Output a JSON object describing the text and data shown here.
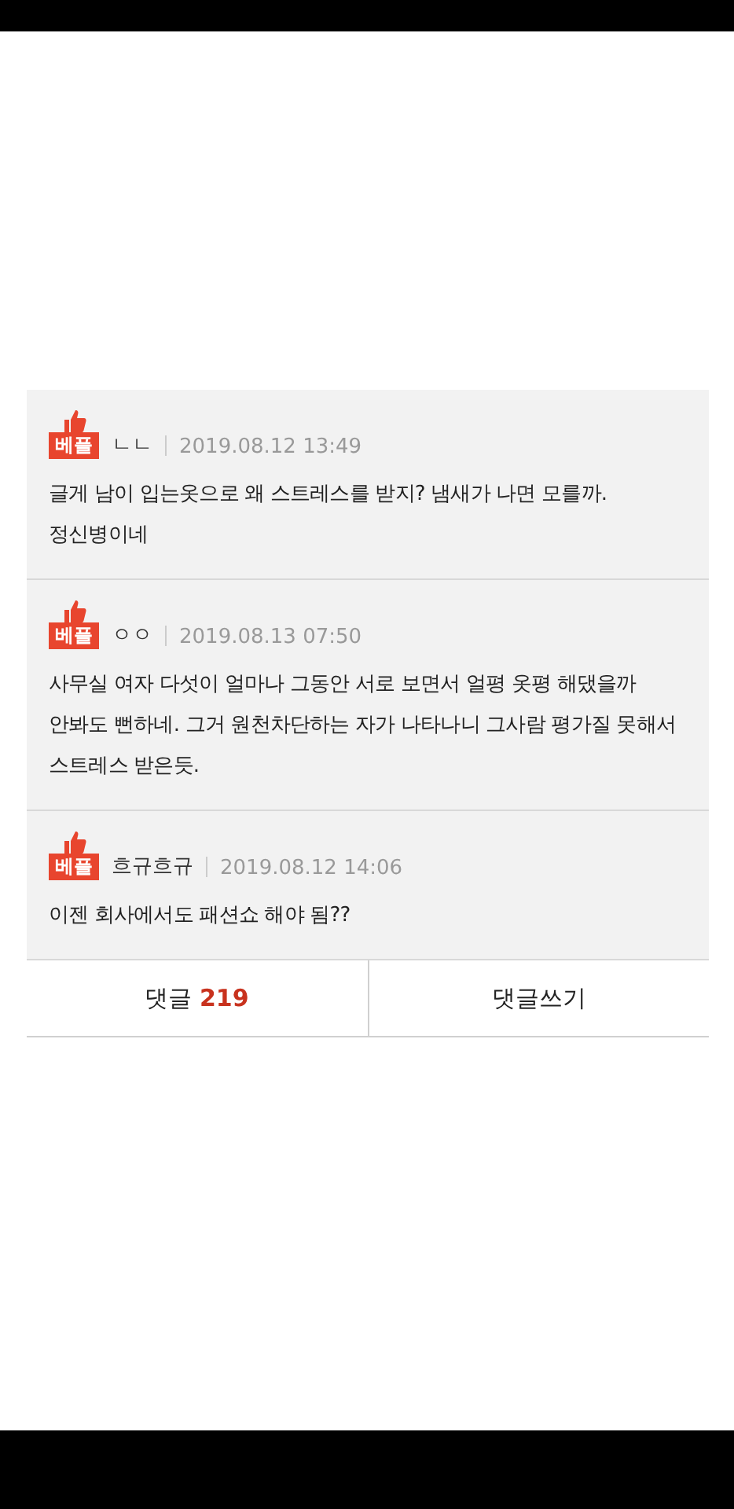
{
  "comments": [
    {
      "badge": "베플",
      "author": "ㄴㄴ",
      "date": "2019.08.12 13:49",
      "text": "글게 남이 입는옷으로 왜 스트레스를 받지? 냄새가 나면 모를까. 정신병이네"
    },
    {
      "badge": "베플",
      "author": "ㅇㅇ",
      "date": "2019.08.13 07:50",
      "text": "사무실 여자 다섯이 얼마나 그동안 서로 보면서 얼평 옷평 해댔을까 안봐도 뻔하네. 그거 원천차단하는 자가 나타나니 그사람 평가질 못해서 스트레스 받은듯."
    },
    {
      "badge": "베플",
      "author": "흐규흐규",
      "date": "2019.08.12 14:06",
      "text": "이젠 회사에서도 패션쇼 해야 됨??"
    }
  ],
  "comment_count": {
    "label": "댓글",
    "count": "219"
  },
  "write_button": "댓글쓰기"
}
